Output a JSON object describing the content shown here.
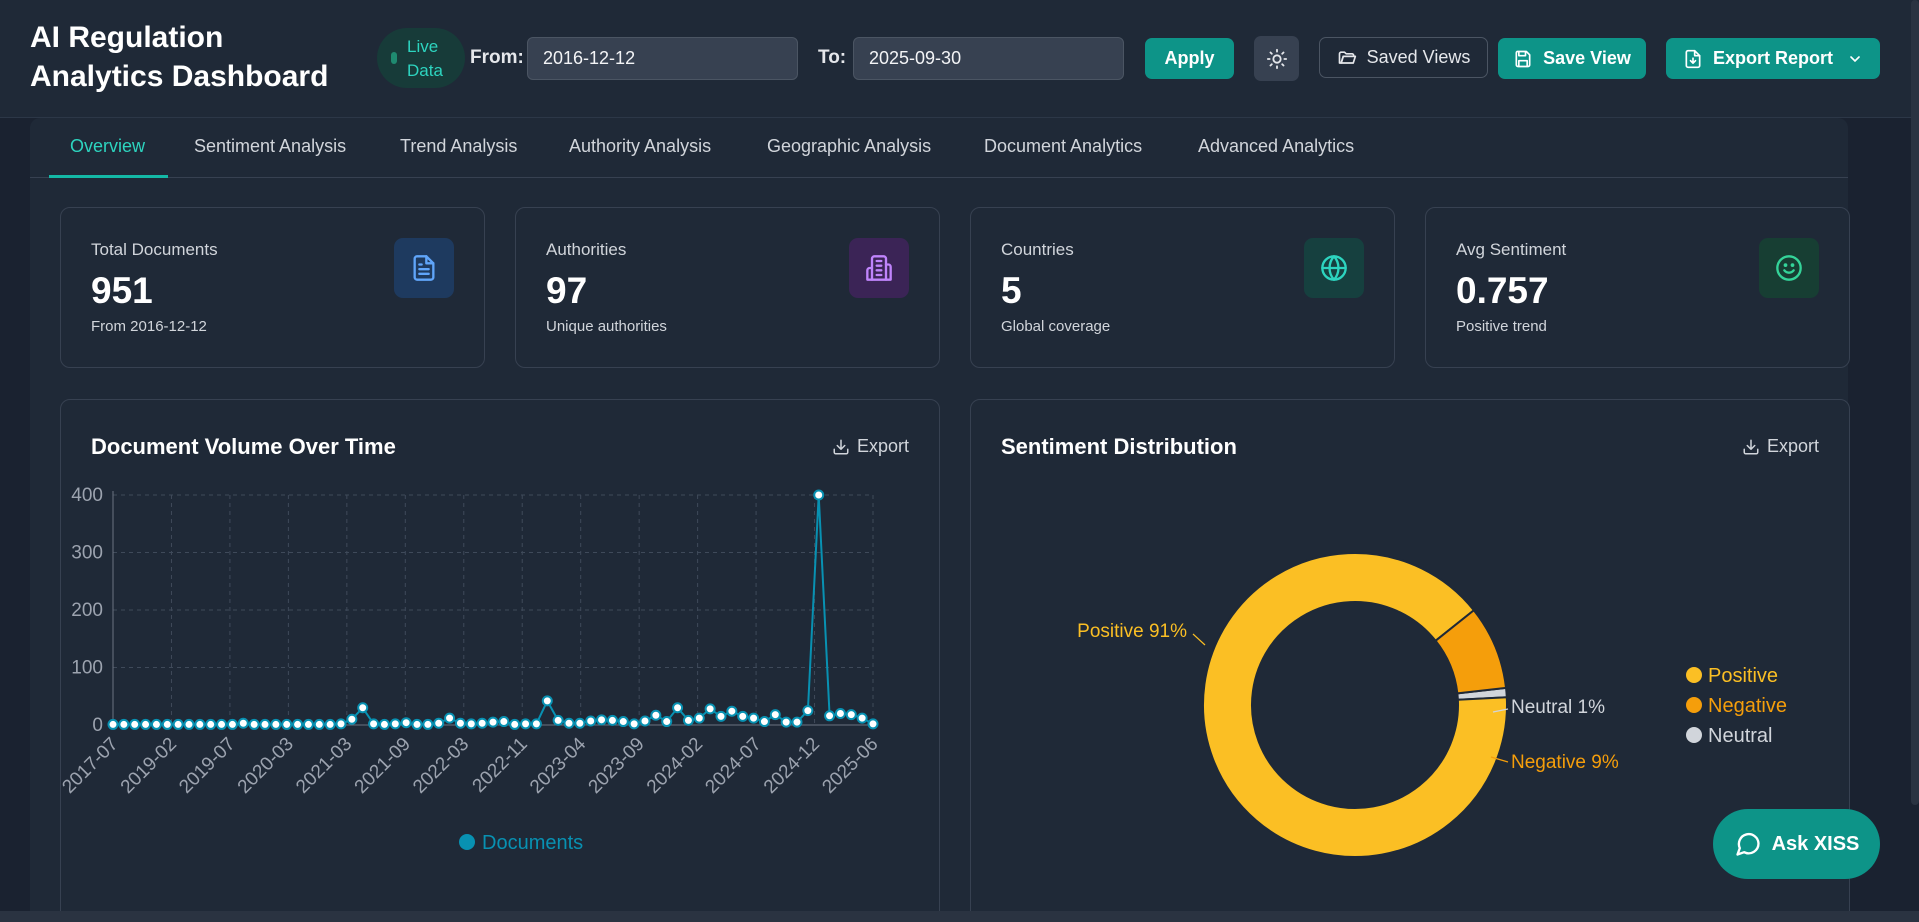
{
  "header": {
    "title": "AI Regulation Analytics Dashboard",
    "live_badge": "Live Data",
    "from_label": "From:",
    "from_value": "2016-12-12",
    "to_label": "To:",
    "to_value": "2025-09-30",
    "apply_label": "Apply",
    "theme_icon": "sun-icon",
    "saved_views_label": "Saved Views",
    "save_view_label": "Save View",
    "export_report_label": "Export Report"
  },
  "tabs": [
    {
      "label": "Overview",
      "active": true
    },
    {
      "label": "Sentiment Analysis"
    },
    {
      "label": "Trend Analysis"
    },
    {
      "label": "Authority Analysis"
    },
    {
      "label": "Geographic Analysis"
    },
    {
      "label": "Document Analytics"
    },
    {
      "label": "Advanced Analytics"
    }
  ],
  "stats": [
    {
      "label": "Total Documents",
      "value": "951",
      "sub": "From 2016-12-12",
      "icon": "document-icon",
      "color": "#60a5fa"
    },
    {
      "label": "Authorities",
      "value": "97",
      "sub": "Unique authorities",
      "icon": "building-icon",
      "color": "#c084fc"
    },
    {
      "label": "Countries",
      "value": "5",
      "sub": "Global coverage",
      "icon": "globe-icon",
      "color": "#2dd4bf"
    },
    {
      "label": "Avg Sentiment",
      "value": "0.757",
      "sub": "Positive trend",
      "icon": "smile-icon",
      "color": "#34d399"
    }
  ],
  "volume_panel": {
    "title": "Document Volume Over Time",
    "export_label": "Export"
  },
  "sentiment_panel": {
    "title": "Sentiment Distribution",
    "export_label": "Export"
  },
  "ask_button": "Ask XISS",
  "chart_data": [
    {
      "type": "line",
      "title": "Document Volume Over Time",
      "xlabel": "",
      "ylabel": "",
      "ylim": [
        0,
        400
      ],
      "yticks": [
        0,
        100,
        200,
        300,
        400
      ],
      "grid": true,
      "legend": "bottom",
      "x_tick_labels": [
        "2017-07",
        "2019-02",
        "2019-07",
        "2020-03",
        "2021-03",
        "2021-09",
        "2022-03",
        "2022-11",
        "2023-04",
        "2023-09",
        "2024-02",
        "2024-07",
        "2024-12",
        "2025-06"
      ],
      "series": [
        {
          "name": "Documents",
          "color": "#0891b2",
          "values": [
            1,
            1,
            1,
            1,
            1,
            1,
            1,
            1,
            1,
            1,
            1,
            1,
            3,
            1,
            1,
            1,
            1,
            1,
            1,
            1,
            1,
            2,
            10,
            30,
            2,
            1,
            2,
            4,
            1,
            1,
            3,
            12,
            3,
            2,
            3,
            5,
            6,
            1,
            2,
            2,
            42,
            8,
            3,
            3,
            7,
            9,
            8,
            6,
            2,
            7,
            17,
            6,
            30,
            8,
            12,
            28,
            15,
            24,
            15,
            12,
            6,
            18,
            5,
            5,
            25,
            400,
            16,
            20,
            18,
            12,
            2
          ]
        }
      ]
    },
    {
      "type": "pie",
      "title": "Sentiment Distribution",
      "legend": "right",
      "slices": [
        {
          "label": "Positive",
          "value": 91,
          "color": "#fbbf24",
          "text": "Positive 91%"
        },
        {
          "label": "Negative",
          "value": 9,
          "color": "#f59e0b",
          "text": "Negative 9%"
        },
        {
          "label": "Neutral",
          "value": 1,
          "color": "#d1d5db",
          "text": "Neutral 1%"
        }
      ]
    }
  ]
}
